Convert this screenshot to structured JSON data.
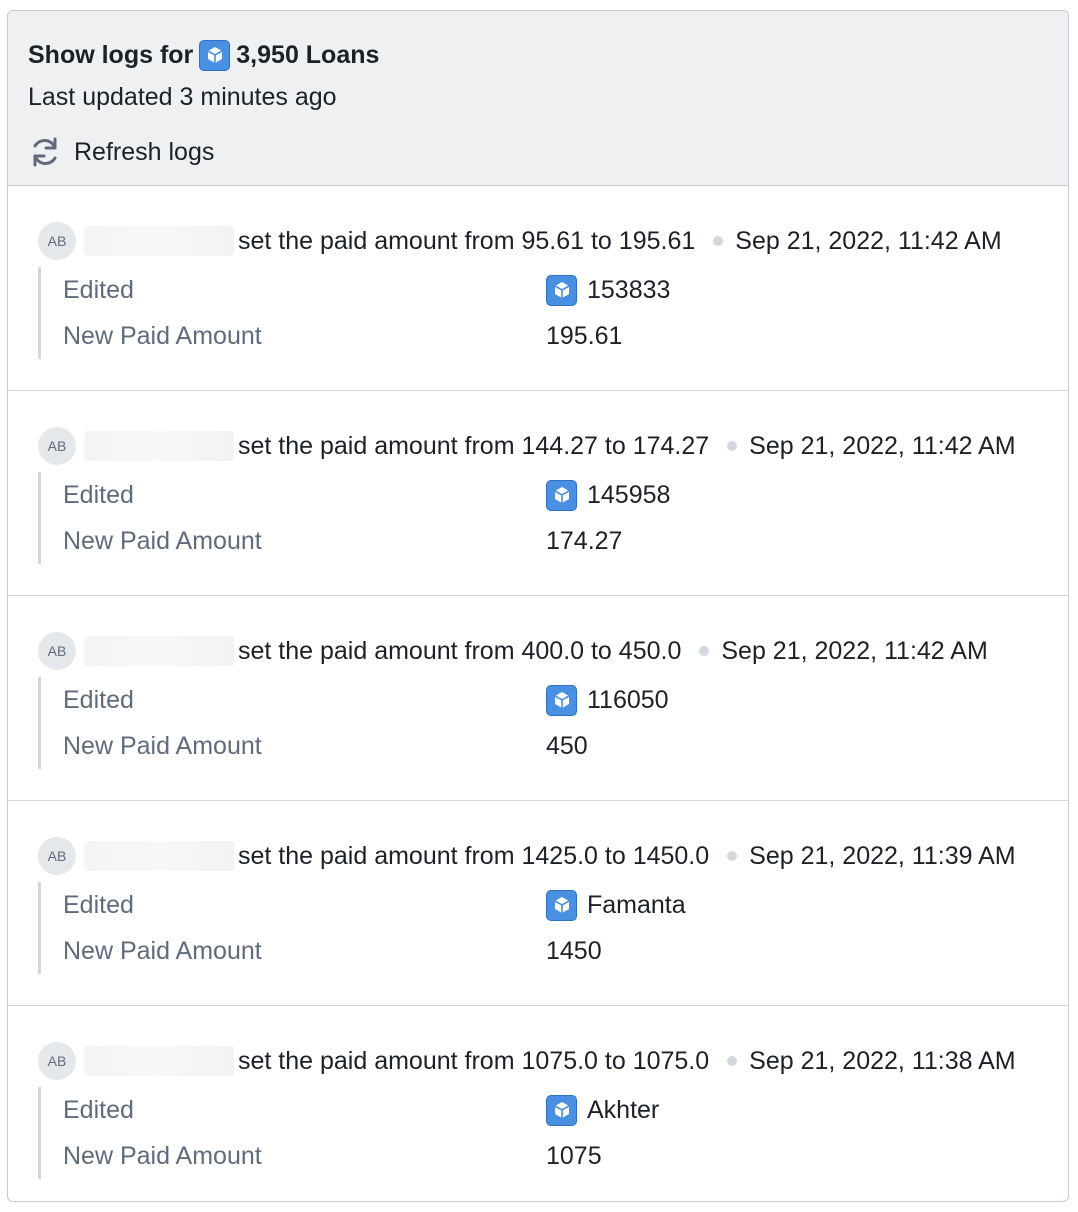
{
  "header": {
    "title_prefix": "Show logs for",
    "object_count_label": "3,950 Loans",
    "last_updated": "Last updated 3 minutes ago",
    "refresh_label": "Refresh logs"
  },
  "colors": {
    "accent": "#4a90e2",
    "header_bg": "#eef0f2",
    "muted_text": "#5f6b7c"
  },
  "logs": [
    {
      "avatar": "AB",
      "message": "set the paid amount from 95.61 to 195.61",
      "timestamp": "Sep 21, 2022, 11:42 AM",
      "edited_label": "Edited",
      "edited_object": "153833",
      "field_label": "New Paid Amount",
      "field_value": "195.61"
    },
    {
      "avatar": "AB",
      "message": "set the paid amount from 144.27 to 174.27",
      "timestamp": "Sep 21, 2022, 11:42 AM",
      "edited_label": "Edited",
      "edited_object": "145958",
      "field_label": "New Paid Amount",
      "field_value": "174.27"
    },
    {
      "avatar": "AB",
      "message": "set the paid amount from 400.0 to 450.0",
      "timestamp": "Sep 21, 2022, 11:42 AM",
      "edited_label": "Edited",
      "edited_object": "116050",
      "field_label": "New Paid Amount",
      "field_value": "450"
    },
    {
      "avatar": "AB",
      "message": "set the paid amount from 1425.0 to 1450.0",
      "timestamp": "Sep 21, 2022, 11:39 AM",
      "edited_label": "Edited",
      "edited_object": "Famanta",
      "field_label": "New Paid Amount",
      "field_value": "1450"
    },
    {
      "avatar": "AB",
      "message": "set the paid amount from 1075.0 to 1075.0",
      "timestamp": "Sep 21, 2022, 11:38 AM",
      "edited_label": "Edited",
      "edited_object": "Akhter",
      "field_label": "New Paid Amount",
      "field_value": "1075"
    }
  ]
}
